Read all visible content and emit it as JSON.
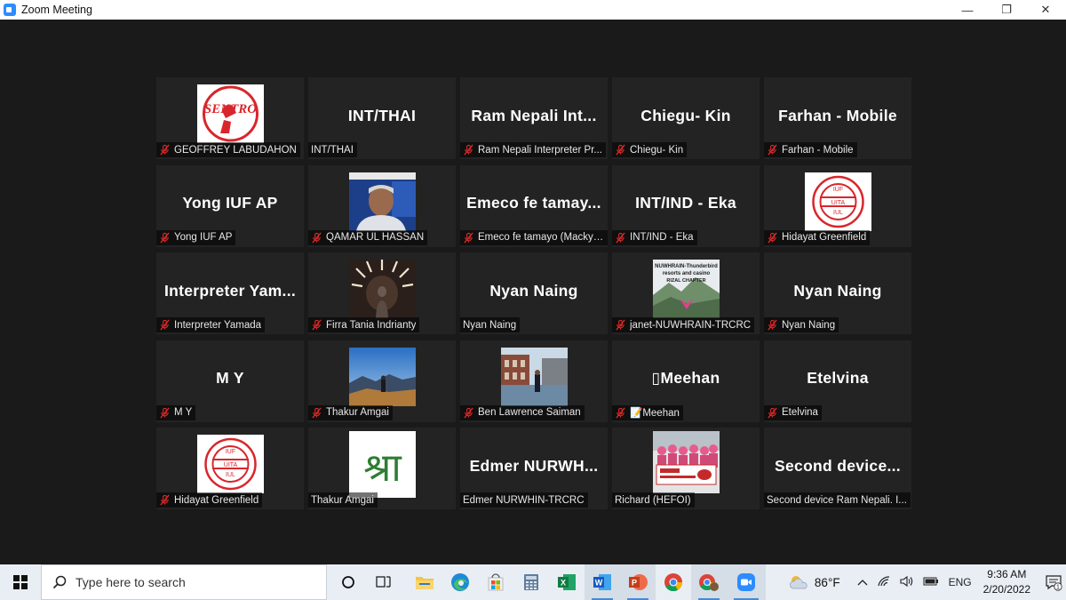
{
  "window": {
    "title": "Zoom Meeting",
    "min_glyph": "—",
    "max_glyph": "❐",
    "close_glyph": "✕"
  },
  "tiles": [
    {
      "big": "",
      "label": "GEOFFREY LABUDAHON",
      "muted": true,
      "pic": "sentro-logo"
    },
    {
      "big": "INT/THAI",
      "label": "INT/THAI",
      "muted": false,
      "pic": ""
    },
    {
      "big": "Ram  Nepali  Int...",
      "label": "Ram Nepali Interpreter Pr...",
      "muted": true,
      "pic": ""
    },
    {
      "big": "Chiegu- Kin",
      "label": "Chiegu- Kin",
      "muted": true,
      "pic": ""
    },
    {
      "big": "Farhan - Mobile",
      "label": "Farhan - Mobile",
      "muted": true,
      "pic": ""
    },
    {
      "big": "Yong IUF AP",
      "label": "Yong IUF AP",
      "muted": true,
      "pic": ""
    },
    {
      "big": "",
      "label": "QAMAR UL HASSAN",
      "muted": true,
      "pic": "portrait-man"
    },
    {
      "big": "Emeco  fe  tamay...",
      "label": "Emeco fe tamayo (Macky)...",
      "muted": true,
      "pic": ""
    },
    {
      "big": "INT/IND - Eka",
      "label": "INT/IND - Eka",
      "muted": true,
      "pic": ""
    },
    {
      "big": "",
      "label": "Hidayat Greenfield",
      "muted": true,
      "pic": "iuf-logo"
    },
    {
      "big": "Interpreter  Yam...",
      "label": "Interpreter Yamada",
      "muted": true,
      "pic": ""
    },
    {
      "big": "",
      "label": "Firra Tania Indrianty",
      "muted": true,
      "pic": "tunnel-photo"
    },
    {
      "big": "Nyan Naing",
      "label": "Nyan Naing",
      "muted": false,
      "pic": ""
    },
    {
      "big": "",
      "label": "janet-NUWHRAIN-TRCRC",
      "muted": true,
      "pic": "nuwhrain-poster"
    },
    {
      "big": "Nyan Naing",
      "label": "Nyan Naing",
      "muted": true,
      "pic": ""
    },
    {
      "big": "M Y",
      "label": "M Y",
      "muted": true,
      "pic": ""
    },
    {
      "big": "",
      "label": "Thakur Amgai",
      "muted": true,
      "pic": "mountain-photo"
    },
    {
      "big": "",
      "label": "Ben Lawrence Saiman",
      "muted": true,
      "pic": "dock-photo"
    },
    {
      "big": "▯Meehan",
      "label": "📝Meehan",
      "muted": true,
      "pic": ""
    },
    {
      "big": "Etelvina",
      "label": "Etelvina",
      "muted": true,
      "pic": ""
    },
    {
      "big": "",
      "label": "Hidayat Greenfield",
      "muted": true,
      "pic": "iuf-logo"
    },
    {
      "big": "",
      "label": "Thakur Amgai",
      "muted": false,
      "pic": "devanagari-logo"
    },
    {
      "big": "Edmer  NURWH...",
      "label": "Edmer NURWHIN-TRCRC",
      "muted": false,
      "pic": ""
    },
    {
      "big": "",
      "label": "Richard (HEFOI)",
      "muted": false,
      "pic": "group-photo"
    },
    {
      "big": "Second  device...",
      "label": "Second device Ram Nepali. I...",
      "muted": false,
      "pic": ""
    }
  ],
  "pictures": {
    "sentro_text": "SENTRO",
    "iuf_top": "IUF",
    "iuf_mid": "UITA",
    "iuf_bot": "IUL",
    "nuwhrain_line1": "NUWHRAIN-Thunderbird",
    "nuwhrain_line2": "resorts and casino",
    "nuwhrain_line3": "RIZAL CHAPTER",
    "devanagari": "श्रा"
  },
  "taskbar": {
    "search_placeholder": "Type here to search",
    "icons": [
      "start-icon",
      "search-icon",
      "cortana-icon",
      "task-view-icon",
      "file-explorer-icon",
      "edge-icon",
      "store-icon",
      "calculator-icon",
      "excel-icon",
      "word-icon",
      "powerpoint-icon",
      "chrome-icon",
      "chrome-profile-icon",
      "zoom-icon"
    ],
    "weather_temp": "86°F",
    "language": "ENG",
    "time": "9:36 AM",
    "date": "2/20/2022",
    "notification_count": "1"
  },
  "colors": {
    "accent_blue": "#2d8cff",
    "mute_red": "#e02828",
    "tile_bg": "#232323",
    "meeting_bg": "#1a1a1a"
  }
}
